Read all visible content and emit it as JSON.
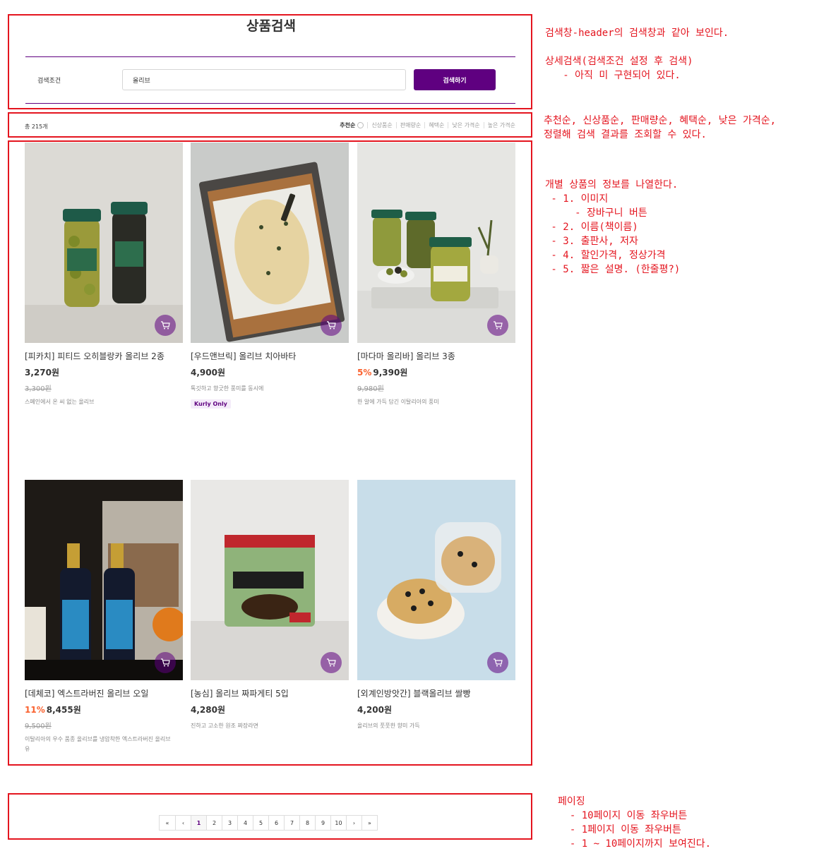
{
  "search": {
    "title": "상품검색",
    "condition_label": "검색조건",
    "input_value": "올리브",
    "button_label": "검색하기"
  },
  "sortbar": {
    "total": "총 215개",
    "options": [
      "추천순",
      "신상품순",
      "판매량순",
      "혜택순",
      "낮은 가격순",
      "높은 가격순"
    ],
    "active_index": 0
  },
  "products": [
    {
      "name": "[피카치] 피티드 오히블랑카 올리브 2종",
      "discount": "",
      "price": "3,270원",
      "original_price": "3,300원",
      "description": "스페인에서 온 씨 없는 올리브",
      "badge": ""
    },
    {
      "name": "[우드앤브릭] 올리브 치아바타",
      "discount": "",
      "price": "4,900원",
      "original_price": "",
      "description": "톡깃하고 향긋한 풍미를 동시에",
      "badge": "Kurly Only"
    },
    {
      "name": "[마다마 올리바] 올리브 3종",
      "discount": "5%",
      "price": "9,390원",
      "original_price": "9,980원",
      "description": "한 알에 가득 담긴 이탈리아의 풍미",
      "badge": ""
    },
    {
      "name": "[데체코] 엑스트라버진 올리브 오일",
      "discount": "11%",
      "price": "8,455원",
      "original_price": "9,500원",
      "description": "이탈리아의 우수 품종 올리브를 냉압착한 엑스트라버진 올리브유",
      "badge": ""
    },
    {
      "name": "[농심] 올리브 짜파게티 5입",
      "discount": "",
      "price": "4,280원",
      "original_price": "",
      "description": "진하고 고소한 원조 짜장라면",
      "badge": ""
    },
    {
      "name": "[외계인방앗간] 블랙올리브 쌀빵",
      "discount": "",
      "price": "4,200원",
      "original_price": "",
      "description": "올리브의 풋풋한 향미 가득",
      "badge": ""
    }
  ],
  "pagination": {
    "first": "«",
    "prev": "‹",
    "pages": [
      "1",
      "2",
      "3",
      "4",
      "5",
      "6",
      "7",
      "8",
      "9",
      "10"
    ],
    "next": "›",
    "last": "»",
    "current": "1"
  },
  "annotations": {
    "note1": "검색창-header의 검색창과 같아 보인다.\n\n상세검색(검색조건 설정 후 검색)\n   - 아직 미 구현되어 있다.",
    "note2": "추천순, 신상품순, 판매량순, 혜택순, 낮은 가격순,\n정렬해 검색 결과를 조회할 수 있다.",
    "note3": "개별 상품의 정보를 나열한다.\n - 1. 이미지\n     - 장바구니 버튼\n - 2. 이름(책이름)\n - 3. 출판사, 저자\n - 4. 할인가격, 정상가격\n - 5. 짧은 설명. (한줄평?)",
    "note4": "페이징\n  - 10페이지 이동 좌우버튼\n  - 1페이지 이동 좌우버튼\n  - 1 ~ 10페이지까지 보여진다."
  },
  "colors": {
    "annotation_red": "#e4151f",
    "brand_purple": "#5f0080",
    "discount_orange": "#fa622f"
  }
}
